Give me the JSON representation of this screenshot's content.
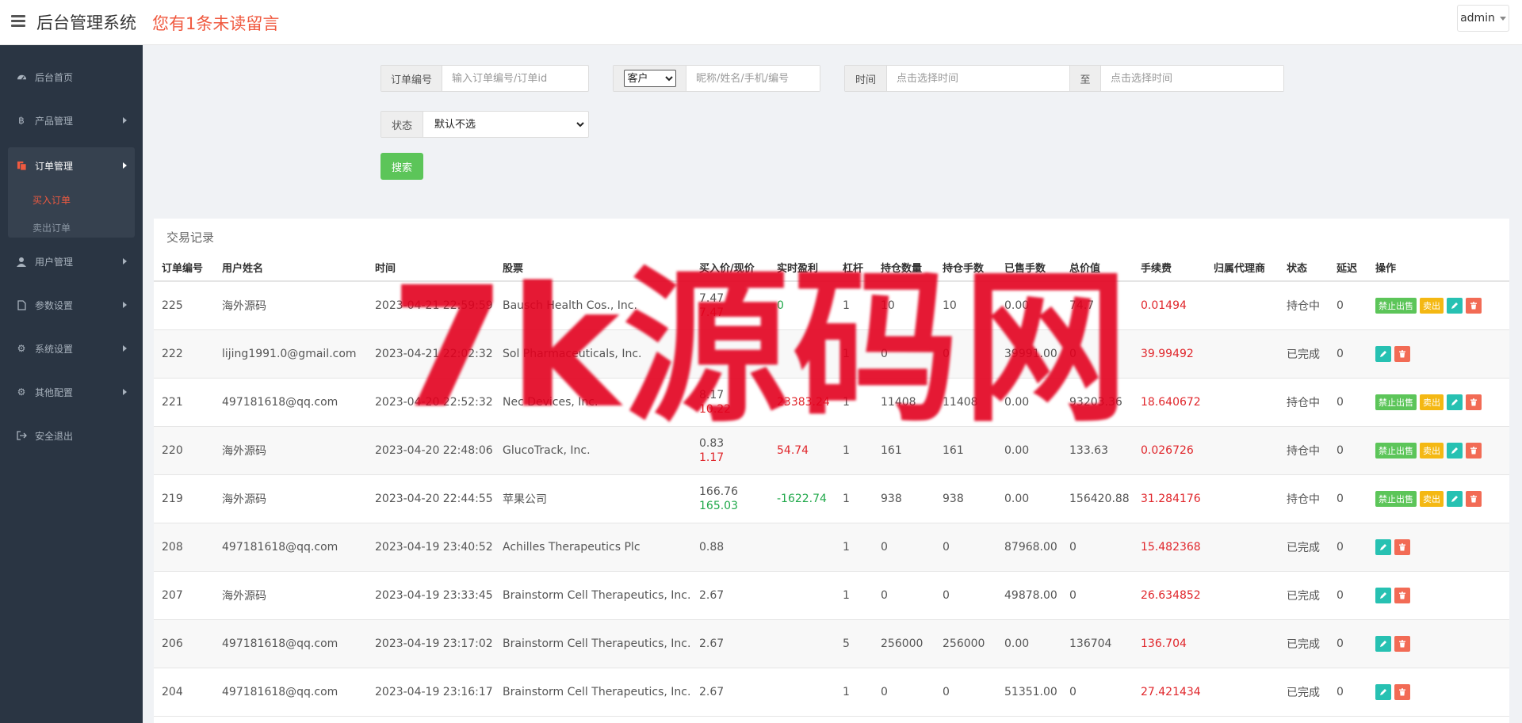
{
  "header": {
    "title": "后台管理系统",
    "unread_notice": "您有1条未读留言",
    "user": "admin"
  },
  "sidebar": {
    "items": [
      {
        "label": "后台首页",
        "icon": "dashboard-icon"
      },
      {
        "label": "产品管理",
        "icon": "bitcoin-icon"
      },
      {
        "label": "订单管理",
        "icon": "copy-icon"
      },
      {
        "label": "用户管理",
        "icon": "user-icon"
      },
      {
        "label": "参数设置",
        "icon": "file-icon"
      },
      {
        "label": "系统设置",
        "icon": "cogs-icon"
      },
      {
        "label": "其他配置",
        "icon": "gear-icon"
      },
      {
        "label": "安全退出",
        "icon": "sign-out-icon"
      }
    ],
    "sub_items": [
      {
        "label": "买入订单"
      },
      {
        "label": "卖出订单"
      }
    ]
  },
  "filters": {
    "order_no_label": "订单编号",
    "order_no_placeholder": "输入订单编号/订单id",
    "customer_select": "客户",
    "customer_placeholder": "昵称/姓名/手机/编号",
    "time_label": "时间",
    "time_start_placeholder": "点击选择时间",
    "to_label": "至",
    "time_end_placeholder": "点击选择时间",
    "status_label": "状态",
    "status_select": "默认不选",
    "search_label": "搜索"
  },
  "panel": {
    "title": "交易记录"
  },
  "table": {
    "columns": [
      "订单编号",
      "用户姓名",
      "时间",
      "股票",
      "买入价/现价",
      "实时盈利",
      "杠杆",
      "持仓数量",
      "持仓手数",
      "已售手数",
      "总价值",
      "手续费",
      "归属代理商",
      "状态",
      "延迟",
      "操作"
    ],
    "rows": [
      {
        "id": "225",
        "user": "海外源码",
        "time": "2023-04-21 22:59:59",
        "stock": "Bausch Health Cos., Inc.",
        "buy": "7.47",
        "now": "7.47",
        "now_color": "red",
        "profit": "0",
        "profit_color": "green",
        "lev": "1",
        "qty": "10",
        "lots": "10",
        "sold": "0.00",
        "total": "74.7",
        "fee": "0.01494",
        "status": "持仓中",
        "delay": "0",
        "holding": true
      },
      {
        "id": "222",
        "user": "lijing1991.0@gmail.com",
        "time": "2023-04-21 22:02:32",
        "stock": "Sol Pharmaceuticals, Inc.",
        "buy": "",
        "now": "",
        "now_color": "",
        "profit": "",
        "profit_color": "",
        "lev": "1",
        "qty": "0",
        "lots": "0",
        "sold": "39991.00",
        "total": "0",
        "fee": "39.99492",
        "status": "已完成",
        "delay": "0",
        "holding": false
      },
      {
        "id": "221",
        "user": "497181618@qq.com",
        "time": "2023-04-20 22:52:32",
        "stock": "Nec Devices, Inc.",
        "buy": "8.17",
        "now": "10.22",
        "now_color": "red",
        "profit": "23383.24",
        "profit_color": "red",
        "lev": "1",
        "qty": "11408",
        "lots": "11408",
        "sold": "0.00",
        "total": "93203.36",
        "fee": "18.640672",
        "status": "持仓中",
        "delay": "0",
        "holding": true
      },
      {
        "id": "220",
        "user": "海外源码",
        "time": "2023-04-20 22:48:06",
        "stock": "GlucoTrack, Inc.",
        "buy": "0.83",
        "now": "1.17",
        "now_color": "red",
        "profit": "54.74",
        "profit_color": "red",
        "lev": "1",
        "qty": "161",
        "lots": "161",
        "sold": "0.00",
        "total": "133.63",
        "fee": "0.026726",
        "status": "持仓中",
        "delay": "0",
        "holding": true
      },
      {
        "id": "219",
        "user": "海外源码",
        "time": "2023-04-20 22:44:55",
        "stock": "苹果公司",
        "buy": "166.76",
        "now": "165.03",
        "now_color": "green",
        "profit": "-1622.74",
        "profit_color": "green",
        "lev": "1",
        "qty": "938",
        "lots": "938",
        "sold": "0.00",
        "total": "156420.88",
        "fee": "31.284176",
        "status": "持仓中",
        "delay": "0",
        "holding": true
      },
      {
        "id": "208",
        "user": "497181618@qq.com",
        "time": "2023-04-19 23:40:52",
        "stock": "Achilles Therapeutics Plc",
        "buy": "0.88",
        "now": "",
        "now_color": "",
        "profit": "",
        "profit_color": "",
        "lev": "1",
        "qty": "0",
        "lots": "0",
        "sold": "87968.00",
        "total": "0",
        "fee": "15.482368",
        "status": "已完成",
        "delay": "0",
        "holding": false
      },
      {
        "id": "207",
        "user": "海外源码",
        "time": "2023-04-19 23:33:45",
        "stock": "Brainstorm Cell Therapeutics, Inc.",
        "buy": "2.67",
        "now": "",
        "now_color": "",
        "profit": "",
        "profit_color": "",
        "lev": "1",
        "qty": "0",
        "lots": "0",
        "sold": "49878.00",
        "total": "0",
        "fee": "26.634852",
        "status": "已完成",
        "delay": "0",
        "holding": false
      },
      {
        "id": "206",
        "user": "497181618@qq.com",
        "time": "2023-04-19 23:17:02",
        "stock": "Brainstorm Cell Therapeutics, Inc.",
        "buy": "2.67",
        "now": "",
        "now_color": "",
        "profit": "",
        "profit_color": "",
        "lev": "5",
        "qty": "256000",
        "lots": "256000",
        "sold": "0.00",
        "total": "136704",
        "fee": "136.704",
        "status": "已完成",
        "delay": "0",
        "holding": false
      },
      {
        "id": "204",
        "user": "497181618@qq.com",
        "time": "2023-04-19 23:16:17",
        "stock": "Brainstorm Cell Therapeutics, Inc.",
        "buy": "2.67",
        "now": "",
        "now_color": "",
        "profit": "",
        "profit_color": "",
        "lev": "1",
        "qty": "0",
        "lots": "0",
        "sold": "51351.00",
        "total": "0",
        "fee": "27.421434",
        "status": "已完成",
        "delay": "0",
        "holding": false
      }
    ],
    "actions": {
      "ban_label": "禁止出售",
      "sell_label": "卖出"
    }
  },
  "watermark": "7k源码网",
  "colors": {
    "accent": "#f05a40",
    "sidebar": "#2a3543",
    "profit_up": "#e0262b",
    "profit_down": "#20a84a",
    "search_button": "#5cc559"
  }
}
